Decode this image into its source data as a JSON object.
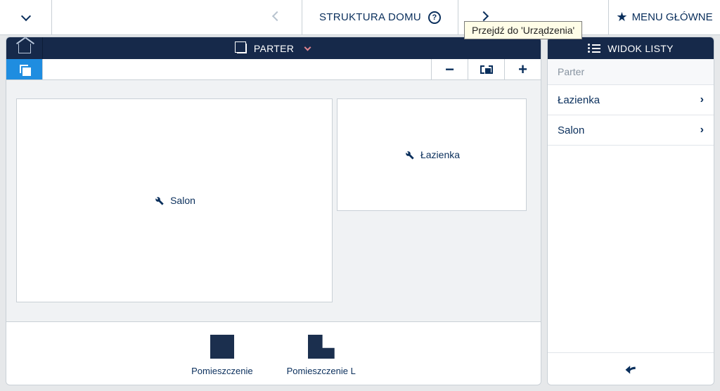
{
  "top": {
    "title": "STRUKTURA DOMU",
    "main_menu": "MENU GŁÓWNE",
    "tooltip_forward": "Przejdź do 'Urządzenia'"
  },
  "canvas": {
    "floor_label": "PARTER",
    "rooms": {
      "salon": "Salon",
      "lazienka": "Łazienka"
    }
  },
  "palette": {
    "rect": "Pomieszczenie",
    "lshape": "Pomieszczenie L"
  },
  "listview": {
    "header": "WIDOK LISTY",
    "section": "Parter",
    "items": [
      {
        "label": "Łazienka"
      },
      {
        "label": "Salon"
      }
    ]
  }
}
